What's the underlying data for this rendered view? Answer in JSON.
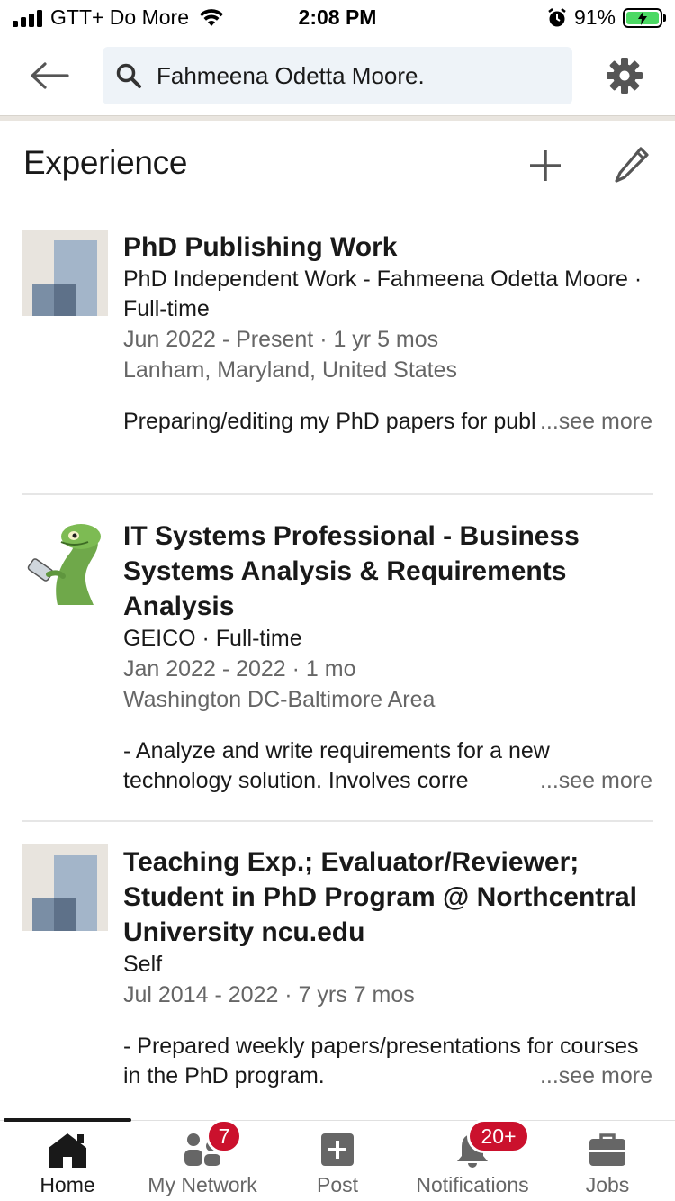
{
  "status_bar": {
    "carrier": "GTT+ Do More",
    "time": "2:08 PM",
    "battery": "91%"
  },
  "header": {
    "search_text": "Fahmeena Odetta Moore."
  },
  "section": {
    "title": "Experience"
  },
  "experiences": [
    {
      "title": "PhD Publishing Work",
      "company": "PhD Independent Work - Fahmeena Odetta Moore · Full-time",
      "dates": "Jun 2022 - Present · 1 yr 5 mos",
      "location": "Lanham, Maryland, United States",
      "description": "Preparing/editing my PhD papers for publishing.",
      "see_more": "...see more"
    },
    {
      "title": "IT Systems Professional - Business Systems Analysis & Requirements Analysis",
      "company": "GEICO · Full-time",
      "dates": "Jan 2022 - 2022 · 1 mo",
      "location": "Washington DC-Baltimore Area",
      "description": "- Analyze and write requirements for a new technology solution. Involves corre",
      "see_more": "...see more"
    },
    {
      "title": "Teaching Exp.; Evaluator/Reviewer; Student in PhD Program @ Northcentral University ncu.edu",
      "company": "Self",
      "dates": "Jul 2014 - 2022 · 7 yrs 7 mos",
      "location": "",
      "description": "- Prepared weekly papers/presentations for courses in the PhD program.",
      "see_more": "...see more"
    }
  ],
  "bottom_nav": {
    "home": "Home",
    "my_network": "My Network",
    "post": "Post",
    "notifications": "Notifications",
    "jobs": "Jobs",
    "network_badge": "7",
    "notifications_badge": "20+"
  },
  "colors": {
    "badge": "#cb112d",
    "battery_fill": "#4cd964",
    "search_bg": "#eef3f8"
  }
}
